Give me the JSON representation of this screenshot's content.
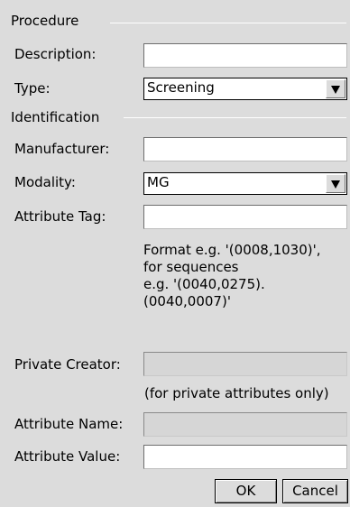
{
  "procedure": {
    "section_title": "Procedure",
    "description": {
      "label": "Description:",
      "value": ""
    },
    "type": {
      "label": "Type:",
      "selected": "Screening"
    }
  },
  "identification": {
    "section_title": "Identification",
    "manufacturer": {
      "label": "Manufacturer:",
      "value": ""
    },
    "modality": {
      "label": "Modality:",
      "selected": "MG"
    },
    "attribute_tag": {
      "label": "Attribute Tag:",
      "value": "",
      "hint": "Format e.g. '(0008,1030)',\nfor sequences\ne.g. '(0040,0275).\n(0040,0007)'"
    },
    "private_creator": {
      "label": "Private Creator:",
      "value": "",
      "hint": "(for private attributes only)"
    },
    "attribute_name": {
      "label": "Attribute Name:",
      "value": ""
    },
    "attribute_value": {
      "label": "Attribute Value:",
      "value": ""
    }
  },
  "buttons": {
    "ok": "OK",
    "cancel": "Cancel"
  },
  "icons": {
    "dropdown": "triangle-down-icon"
  }
}
